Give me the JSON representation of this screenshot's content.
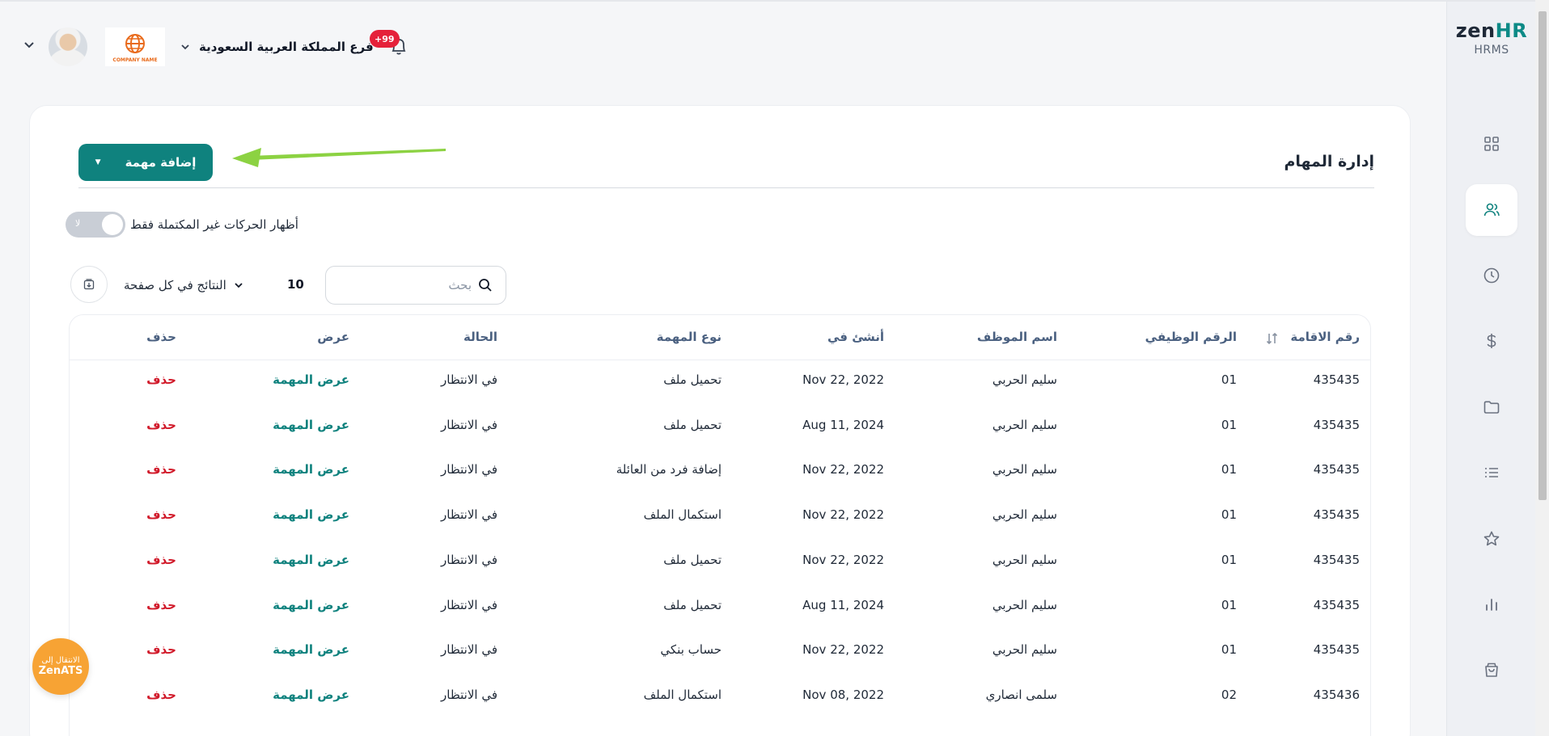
{
  "brand": {
    "logo_main": "zen",
    "logo_hr": "HR",
    "logo_sub": "HRMS"
  },
  "header": {
    "branch": "فرع المملكة العربية السعودية",
    "notifications_badge": "+99",
    "company_logo_text": "COMPANY NAME"
  },
  "page": {
    "title": "إدارة المهام",
    "add_button": "إضافة مهمة"
  },
  "filters": {
    "toggle_label": "أظهار الحركات غير المكتملة فقط",
    "toggle_state": "لا",
    "per_page_label": "النتائج في كل صفحة",
    "per_page_value": "10",
    "search_placeholder": "بحث"
  },
  "table": {
    "columns": {
      "residence": "رقم الاقامة",
      "job_number": "الرقم الوظيفي",
      "employee": "اسم الموظف",
      "created": "أنشئ في",
      "task_type": "نوع المهمة",
      "status": "الحالة",
      "view": "عرض",
      "delete": "حذف"
    },
    "rows": [
      {
        "residence": "435435",
        "job_number": "01",
        "employee": "سليم الحربي",
        "created": "Nov 22, 2022",
        "task_type": "تحميل ملف",
        "status": "في الانتظار",
        "view": "عرض المهمة",
        "delete": "حذف"
      },
      {
        "residence": "435435",
        "job_number": "01",
        "employee": "سليم الحربي",
        "created": "Aug 11, 2024",
        "task_type": "تحميل ملف",
        "status": "في الانتظار",
        "view": "عرض المهمة",
        "delete": "حذف"
      },
      {
        "residence": "435435",
        "job_number": "01",
        "employee": "سليم الحربي",
        "created": "Nov 22, 2022",
        "task_type": "إضافة فرد من العائلة",
        "status": "في الانتظار",
        "view": "عرض المهمة",
        "delete": "حذف"
      },
      {
        "residence": "435435",
        "job_number": "01",
        "employee": "سليم الحربي",
        "created": "Nov 22, 2022",
        "task_type": "استكمال الملف",
        "status": "في الانتظار",
        "view": "عرض المهمة",
        "delete": "حذف"
      },
      {
        "residence": "435435",
        "job_number": "01",
        "employee": "سليم الحربي",
        "created": "Nov 22, 2022",
        "task_type": "تحميل ملف",
        "status": "في الانتظار",
        "view": "عرض المهمة",
        "delete": "حذف"
      },
      {
        "residence": "435435",
        "job_number": "01",
        "employee": "سليم الحربي",
        "created": "Aug 11, 2024",
        "task_type": "تحميل ملف",
        "status": "في الانتظار",
        "view": "عرض المهمة",
        "delete": "حذف"
      },
      {
        "residence": "435435",
        "job_number": "01",
        "employee": "سليم الحربي",
        "created": "Nov 22, 2022",
        "task_type": "حساب بنكي",
        "status": "في الانتظار",
        "view": "عرض المهمة",
        "delete": "حذف"
      },
      {
        "residence": "435436",
        "job_number": "02",
        "employee": "سلمى انصاري",
        "created": "Nov 08, 2022",
        "task_type": "استكمال الملف",
        "status": "في الانتظار",
        "view": "عرض المهمة",
        "delete": "حذف"
      }
    ]
  },
  "zenats": {
    "line1": "الانتقال إلى",
    "line2": "ZenATS"
  },
  "colors": {
    "primary": "#0f827e",
    "danger": "#d11a2a",
    "badge": "#e5213a",
    "header_text": "#4a6080",
    "zenats": "#f7a334"
  }
}
